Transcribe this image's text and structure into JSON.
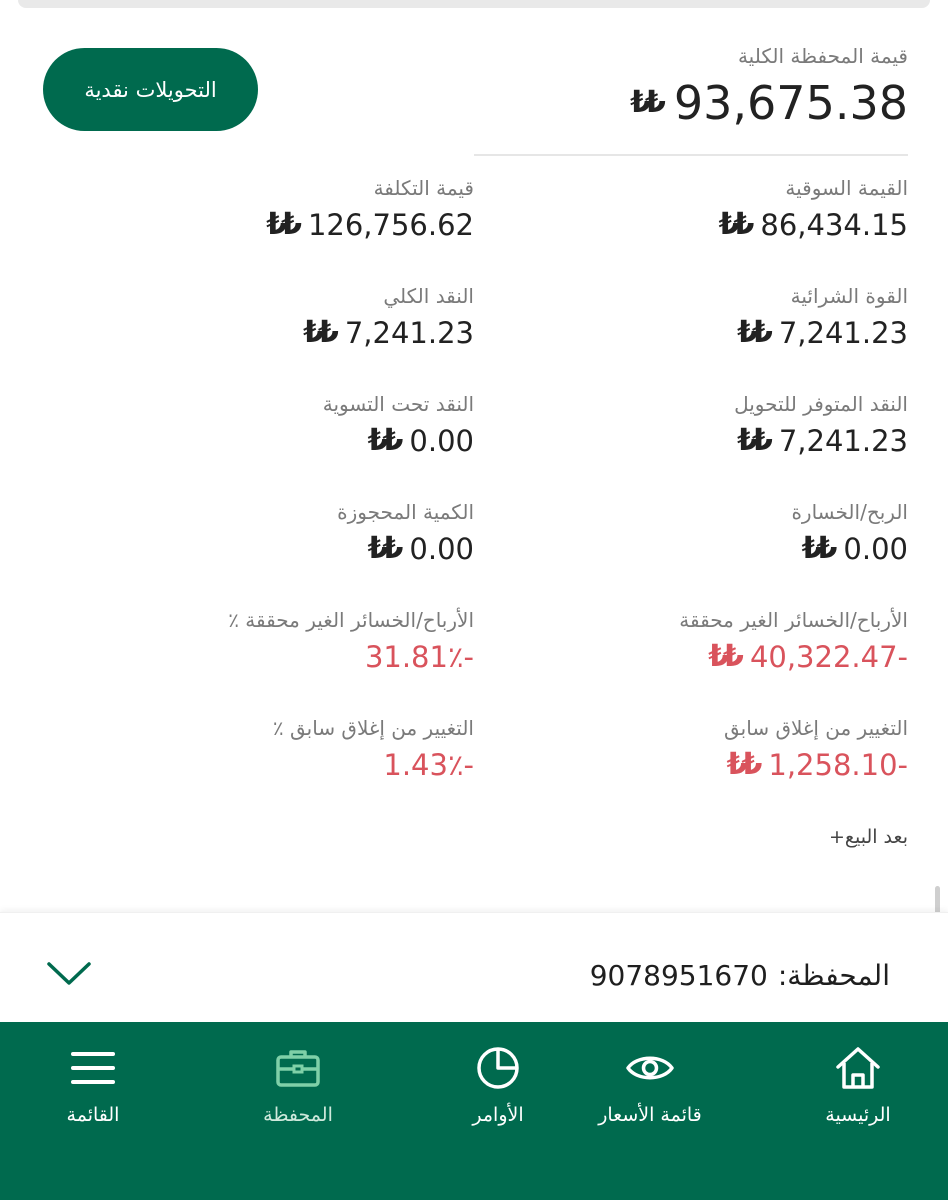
{
  "header": {
    "transfers_button": "التحويلات نقدية",
    "total_label": "قيمة المحفظة الكلية",
    "total_value": "93,675.38"
  },
  "metrics": {
    "market_value": {
      "label": "القيمة السوقية",
      "value": "86,434.15"
    },
    "cost_value": {
      "label": "قيمة التكلفة",
      "value": "126,756.62"
    },
    "buying_power": {
      "label": "القوة الشرائية",
      "value": "7,241.23"
    },
    "total_cash": {
      "label": "النقد الكلي",
      "value": "7,241.23"
    },
    "cash_available_transfer": {
      "label": "النقد المتوفر للتحويل",
      "value": "7,241.23"
    },
    "cash_under_settlement": {
      "label": "النقد تحت التسوية",
      "value": "0.00"
    },
    "profit_loss": {
      "label": "الربح/الخسارة",
      "value": "0.00"
    },
    "reserved_qty": {
      "label": "الكمية المحجوزة",
      "value": "0.00"
    },
    "unrealized_pl": {
      "label": "الأرباح/الخسائر الغير محققة",
      "value": "40,322.47-"
    },
    "unrealized_pl_pct": {
      "label": "الأرباح/الخسائر الغير محققة ٪",
      "value": "31.81٪-"
    },
    "change_prev_close": {
      "label": "التغيير من إغلاق سابق",
      "value": "1,258.10-"
    },
    "change_prev_close_pct": {
      "label": "التغيير من إغلاق سابق ٪",
      "value": "1.43٪-"
    }
  },
  "after_sale_label": "بعد البيع+",
  "portfolio": {
    "label": "المحفظة:",
    "number": "9078951670"
  },
  "nav": {
    "home": "الرئيسية",
    "watchlist": "قائمة الأسعار",
    "orders": "الأوامر",
    "portfolio": "المحفظة",
    "menu": "القائمة"
  },
  "colors": {
    "brand": "#006a4e",
    "negative": "#d9535c",
    "active_icon": "#7fd0a8"
  },
  "icons": {
    "currency": "riyal-icon",
    "home": "home-icon",
    "watchlist": "eye-icon",
    "orders": "pie-icon",
    "portfolio": "briefcase-icon",
    "menu": "menu-icon",
    "expand": "chevron-down-icon"
  }
}
